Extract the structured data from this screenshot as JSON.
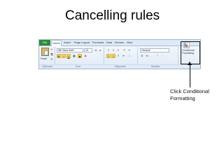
{
  "slide": {
    "title": "Cancelling rules",
    "callout_line1": "Click Conditional",
    "callout_line2": "Formatting"
  },
  "ribbon": {
    "tabs": [
      "File",
      "Home",
      "Insert",
      "Page Layout",
      "Formulas",
      "Data",
      "Review",
      "View"
    ],
    "active_tab": "Home",
    "file_tab_color": "#2e8b3a",
    "font_name": "Wb Sans Serif",
    "font_size": "10",
    "number_format": "General",
    "paste_label": "Paste",
    "groups": [
      "Clipboard",
      "Font",
      "Alignment",
      "Number"
    ],
    "conditional_formatting_line1": "Conditional",
    "conditional_formatting_line2": "Formatting",
    "bold": "B",
    "italic": "I",
    "underline": "U",
    "currency": "$",
    "percent": "%"
  }
}
